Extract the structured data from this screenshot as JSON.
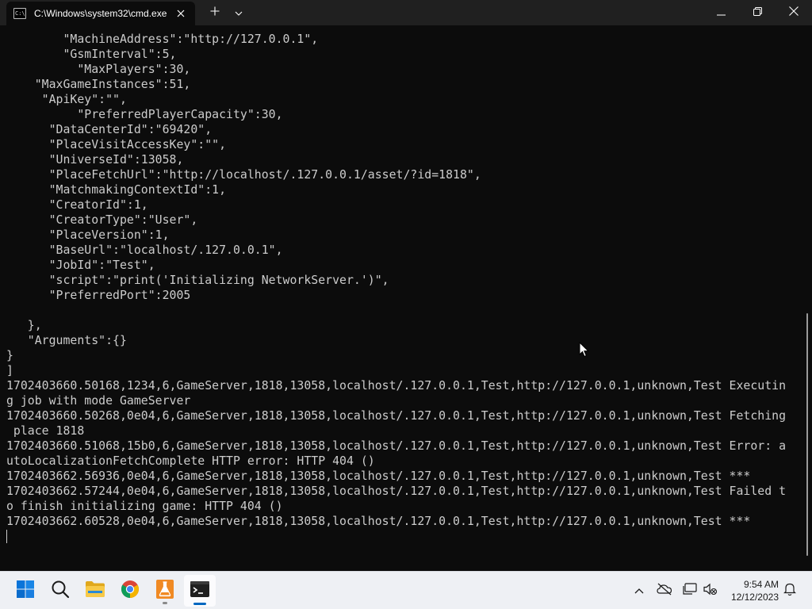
{
  "window": {
    "tab_title": "C:\\Windows\\system32\\cmd.exe",
    "tab_icon_text": "C:\\",
    "controls": [
      "minimize-icon",
      "maximize-icon",
      "close-icon"
    ]
  },
  "console": {
    "lines": [
      "        \"MachineAddress\":\"http://127.0.0.1\",",
      "        \"GsmInterval\":5,",
      "          \"MaxPlayers\":30,",
      "    \"MaxGameInstances\":51,",
      "     \"ApiKey\":\"\",",
      "          \"PreferredPlayerCapacity\":30,",
      "      \"DataCenterId\":\"69420\",",
      "      \"PlaceVisitAccessKey\":\"\",",
      "      \"UniverseId\":13058,",
      "      \"PlaceFetchUrl\":\"http://localhost/.127.0.0.1/asset/?id=1818\",",
      "      \"MatchmakingContextId\":1,",
      "      \"CreatorId\":1,",
      "      \"CreatorType\":\"User\",",
      "      \"PlaceVersion\":1,",
      "      \"BaseUrl\":\"localhost/.127.0.0.1\",",
      "      \"JobId\":\"Test\",",
      "      \"script\":\"print('Initializing NetworkServer.')\",",
      "      \"PreferredPort\":2005",
      "",
      "   },",
      "   \"Arguments\":{}",
      "}",
      "]",
      "1702403660.50168,1234,6,GameServer,1818,13058,localhost/.127.0.0.1,Test,http://127.0.0.1,unknown,Test Executin",
      "g job with mode GameServer",
      "1702403660.50268,0e04,6,GameServer,1818,13058,localhost/.127.0.0.1,Test,http://127.0.0.1,unknown,Test Fetching",
      " place 1818",
      "1702403660.51068,15b0,6,GameServer,1818,13058,localhost/.127.0.0.1,Test,http://127.0.0.1,unknown,Test Error: a",
      "utoLocalizationFetchComplete HTTP error: HTTP 404 ()",
      "1702403662.56936,0e04,6,GameServer,1818,13058,localhost/.127.0.0.1,Test,http://127.0.0.1,unknown,Test ***",
      "1702403662.57244,0e04,6,GameServer,1818,13058,localhost/.127.0.0.1,Test,http://127.0.0.1,unknown,Test Failed t",
      "o finish initializing game: HTTP 404 ()",
      "1702403662.60528,0e04,6,GameServer,1818,13058,localhost/.127.0.0.1,Test,http://127.0.0.1,unknown,Test ***"
    ]
  },
  "taskbar": {
    "apps": [
      {
        "name": "windows-start-icon",
        "active": false
      },
      {
        "name": "search-icon",
        "active": false
      },
      {
        "name": "file-explorer-icon",
        "active": false
      },
      {
        "name": "chrome-icon",
        "active": false
      },
      {
        "name": "flask-app-icon",
        "active": false
      },
      {
        "name": "terminal-icon",
        "active": true
      }
    ],
    "tray": [
      "chevron-up-icon",
      "onedrive-offline-icon",
      "network-icon",
      "volume-muted-icon",
      "notifications-icon"
    ],
    "clock": {
      "time": "9:54 AM",
      "date": "12/12/2023"
    }
  },
  "colors": {
    "console_bg": "#0c0c0c",
    "console_fg": "#cccccc",
    "titlebar_bg": "#202020",
    "taskbar_bg": "#eef0f4",
    "accent": "#0067c0"
  }
}
